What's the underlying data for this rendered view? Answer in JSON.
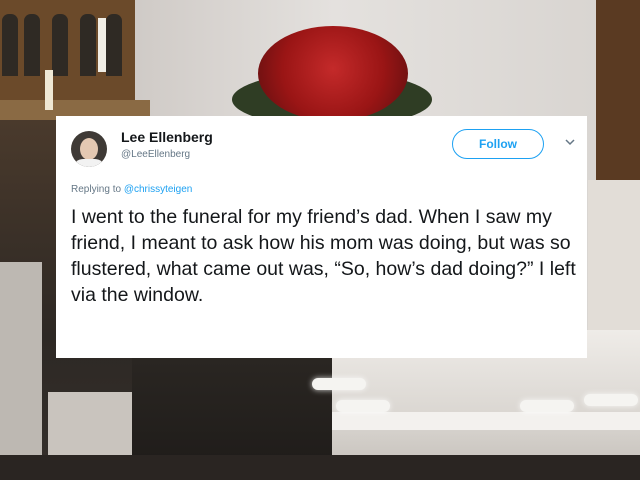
{
  "tweet": {
    "author_name": "Lee Ellenberg",
    "author_handle": "@LeeEllenberg",
    "follow_label": "Follow",
    "replying_prefix": "Replying to ",
    "replying_to": "@chrissyteigen",
    "text": "I went to the funeral for my friend’s dad. When I saw my friend, I meant to ask how his mom was doing, but was so flustered, what came out was, “So, how’s dad doing?” I left via the window."
  },
  "colors": {
    "accent": "#1da1f2",
    "text_primary": "#14171a",
    "text_secondary": "#657786"
  },
  "icons": {
    "menu": "chevron-down-icon",
    "avatar": "avatar"
  }
}
